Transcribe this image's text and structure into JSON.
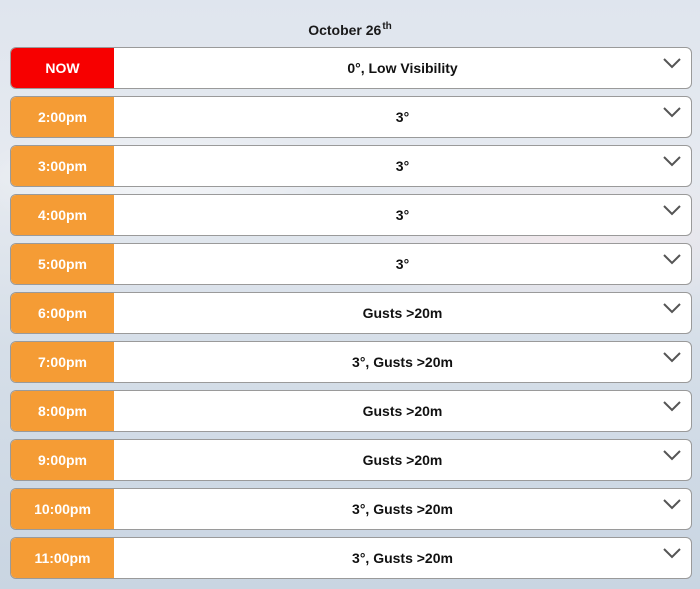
{
  "header": {
    "date": "October 26",
    "suffix": "th"
  },
  "rows": [
    {
      "time": "NOW",
      "summary": "0°, Low Visibility",
      "status": "now"
    },
    {
      "time": "2:00pm",
      "summary": "3°"
    },
    {
      "time": "3:00pm",
      "summary": "3°"
    },
    {
      "time": "4:00pm",
      "summary": "3°"
    },
    {
      "time": "5:00pm",
      "summary": "3°"
    },
    {
      "time": "6:00pm",
      "summary": "Gusts >20m"
    },
    {
      "time": "7:00pm",
      "summary": "3°, Gusts >20m"
    },
    {
      "time": "8:00pm",
      "summary": "Gusts >20m"
    },
    {
      "time": "9:00pm",
      "summary": "Gusts >20m"
    },
    {
      "time": "10:00pm",
      "summary": "3°, Gusts >20m"
    },
    {
      "time": "11:00pm",
      "summary": "3°, Gusts >20m"
    }
  ],
  "icons": {
    "expand": "chevron-down-icon"
  },
  "colors": {
    "now": "#f70000",
    "hour": "#f59c35"
  }
}
